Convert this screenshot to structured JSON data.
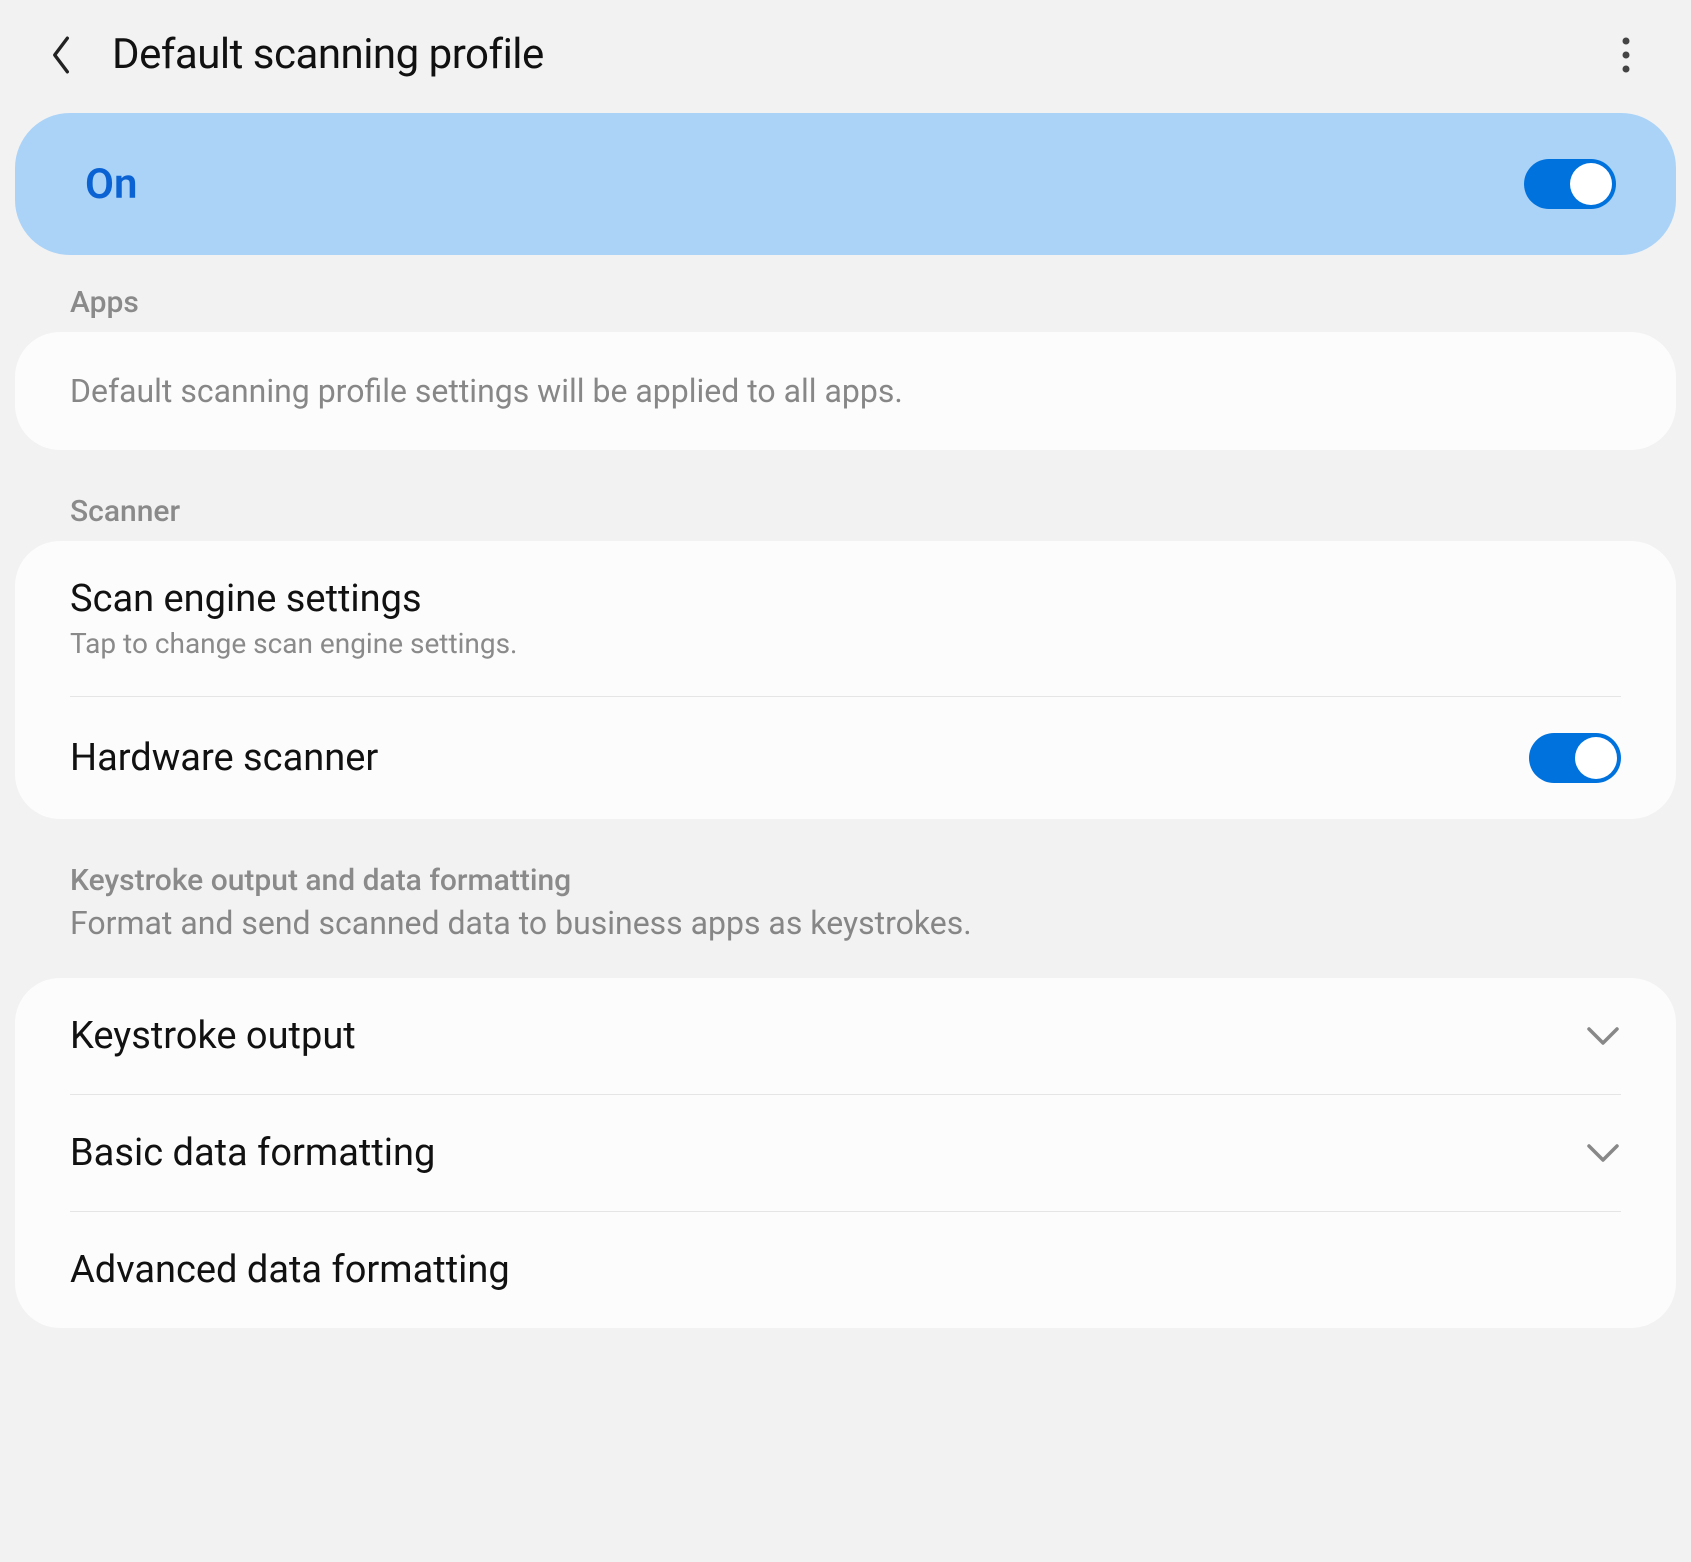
{
  "header": {
    "title": "Default scanning profile"
  },
  "toggle": {
    "label": "On",
    "state": "on"
  },
  "sections": {
    "apps": {
      "label": "Apps",
      "info": "Default scanning profile settings will be applied to all apps."
    },
    "scanner": {
      "label": "Scanner",
      "rows": {
        "engine": {
          "title": "Scan engine settings",
          "subtitle": "Tap to change scan engine settings."
        },
        "hardware": {
          "title": "Hardware scanner",
          "state": "on"
        }
      }
    },
    "keystroke": {
      "label": "Keystroke output and data formatting",
      "sublabel": "Format and send scanned data to business apps as keystrokes.",
      "rows": {
        "output": {
          "title": "Keystroke output"
        },
        "basic": {
          "title": "Basic data formatting"
        },
        "advanced": {
          "title": "Advanced data formatting"
        }
      }
    }
  }
}
